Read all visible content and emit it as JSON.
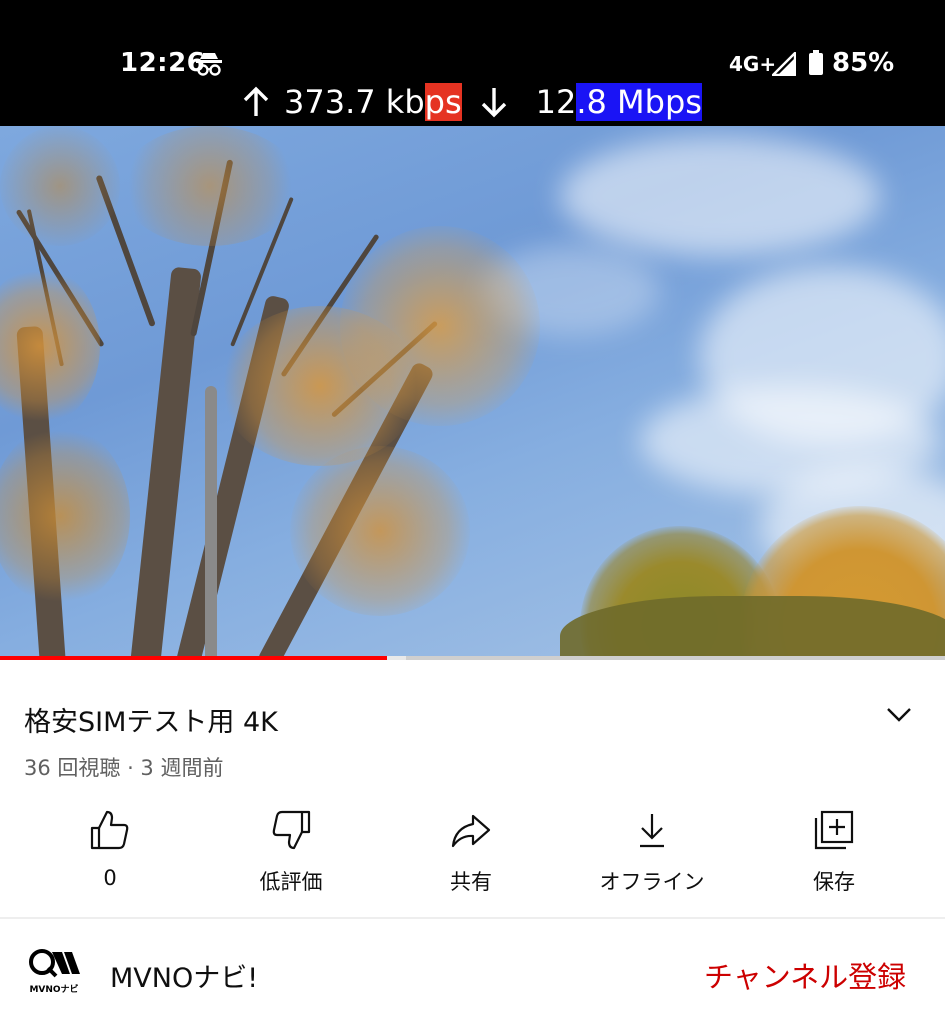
{
  "status_bar": {
    "time": "12:26",
    "network": "4G+",
    "battery": "85%",
    "upload_speed": "373.7 kbps",
    "download_speed": "12.8 Mbps",
    "icons": [
      "incognito-icon",
      "signal-icon",
      "battery-icon",
      "up-arrow-icon",
      "down-arrow-icon"
    ]
  },
  "player": {
    "progress_fraction": 0.41,
    "buffered_fraction": 0.43
  },
  "video": {
    "title": "格安SIMテスト用 4K",
    "meta": "36 回視聴 · 3 週間前"
  },
  "actions": {
    "like_label": "0",
    "dislike_label": "低評価",
    "share_label": "共有",
    "offline_label": "オフライン",
    "save_label": "保存"
  },
  "channel": {
    "name": "MVNOナビ!",
    "logo_text": "MVNOナビ",
    "subscribe_label": "チャンネル登録"
  },
  "colors": {
    "accent": "#cc0000",
    "progress": "#ff0000",
    "upload_highlight": "#e53322",
    "download_highlight": "#1a14f5"
  }
}
